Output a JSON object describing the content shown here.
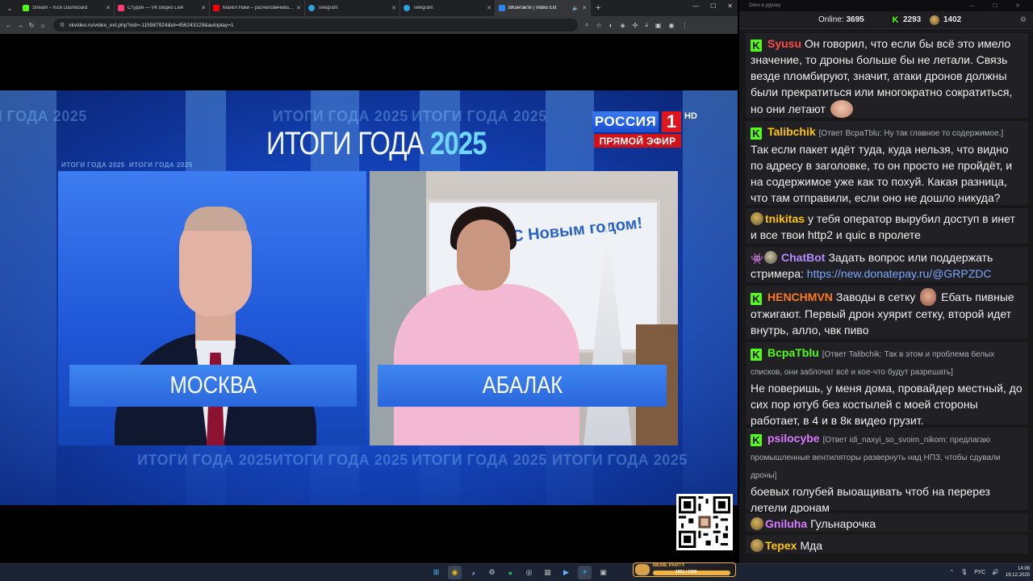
{
  "browser": {
    "tabs": [
      {
        "label": "Stream – Kick Dashboard",
        "color": "#53fc18"
      },
      {
        "label": "Студия — VK Видео Live",
        "color": "#ff3d6e"
      },
      {
        "label": "Майкл Наки – расчеловечивание",
        "color": "#ff0000"
      },
      {
        "label": "Telegram",
        "color": "#2aa3e0"
      },
      {
        "label": "Telegram",
        "color": "#2aa3e0"
      },
      {
        "label": "ВКонтакте | Video Ext",
        "color": "#2787f5"
      }
    ],
    "url": "vkvideo.ru/video_ext.php?oid=-115987924&id=456243129&autoplay=1"
  },
  "broadcast": {
    "bg_word": "ИТОГИ ГОДА",
    "bg_year": "2025",
    "title_word": "ИТОГИ ГОДА",
    "title_year": "2025",
    "channel_name": "РОССИЯ",
    "channel_number": "1",
    "channel_hd": "HD",
    "live_label": "ПРЯМОЙ ЭФИР",
    "left_location": "МОСКВА",
    "right_location": "АБАЛАК",
    "board_text": "С Новым годом!"
  },
  "chat": {
    "window_title": "Окно в дураку",
    "online_label": "Online:",
    "online_count": "3695",
    "followers": "2293",
    "rewards": "1402",
    "messages": [
      {
        "user": "Syusu",
        "color": "#ff4d4d",
        "badge": "kick",
        "text": "Он говорил, что если бы всё это имело значение, то дроны больше бы не летали. Связь везде пломбируют, значит, атаки дронов должны были прекратиться или многократно сократиться, но они летают",
        "emote": true
      },
      {
        "user": "Talibchik",
        "color": "#ffc400",
        "badge": "kick",
        "reply": "[Ответ BcpaTblu: Ну так главное то содержимое.]",
        "text": "Так если пакет идёт туда, куда нельзя, что видно по адресу в заголовке, то он просто не пройдёт, и на содержимое уже как то похуй. Какая разница, что там отправили, если оно не дошло никуда?"
      },
      {
        "user": "tnikitas",
        "color": "#ffc400",
        "badge": "avatar",
        "text": "у тебя оператор вырубил доступ в инет и все твои http2 и quic  в пролете"
      },
      {
        "user": "ChatBot",
        "color": "#b48cff",
        "badge": "bot",
        "text": "Задать вопрос или поддержать стримера:",
        "link": "https://new.donatepay.ru/@GRPZDC"
      },
      {
        "user": "HENCHMVN",
        "color": "#ff7a1a",
        "badge": "kick",
        "text_a": "Заводы в сетку",
        "text_b": "Ебать пивные отжигают. Первый дрон хуярит сетку, второй идет внутрь, алло, чвк пиво"
      },
      {
        "user": "BcpaTblu",
        "color": "#53fc18",
        "badge": "kick",
        "reply": "[Ответ Talibchik: Так в этом и проблема белых списков, они заблочат всё и кое-что будут разрешать]",
        "text": "Не поверишь, у меня дома, провайдер местный, до сих пор ютуб без костылей с моей стороны работает, в 4 и в 8к видео грузит."
      },
      {
        "user": "psilocybe",
        "color": "#d97bff",
        "badge": "kick",
        "reply": "[Ответ idi_naxyi_so_svoim_nikom: предлагаю промышленные вентиляторы развернуть над НПЗ, чтобы сдували дроны]",
        "text": "боевых голубей выоащивать чтоб на перерез летели дронам"
      },
      {
        "user": "Gniluha",
        "color": "#d97bff",
        "badge": "avatar",
        "text": "Гульнарочка"
      },
      {
        "user": "Tepex",
        "color": "#ffc400",
        "badge": "avatar",
        "text": "Мда"
      }
    ]
  },
  "taskbar": {
    "meme_title": "MEME PARTY",
    "meme_count": "1821 / 1500",
    "meme_progress": 1.0,
    "lang": "РУС",
    "time": "14:08",
    "date": "19.12.2025"
  }
}
